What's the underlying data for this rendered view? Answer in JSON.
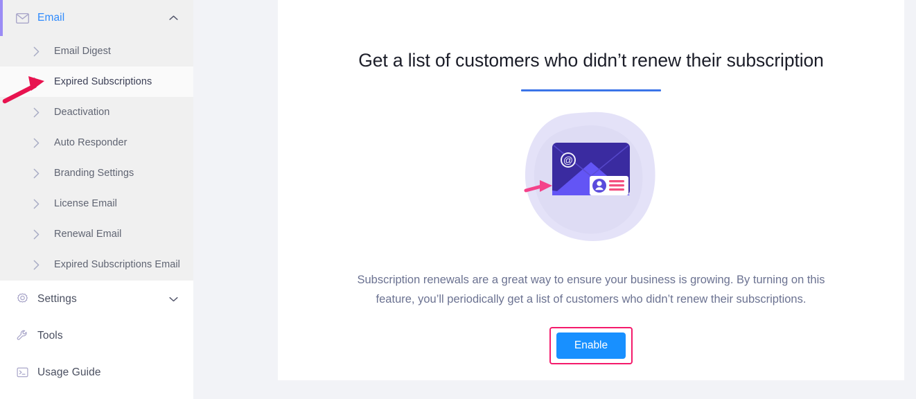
{
  "sidebar": {
    "group": {
      "label": "Email",
      "icon": "envelope-icon",
      "chevron": "chevron-up-icon",
      "expanded": true,
      "accent_color": "#9b8cf5",
      "label_color": "#2f8bfd"
    },
    "subitems": [
      {
        "label": "Email Digest",
        "icon": "chevron-right-icon",
        "active": false
      },
      {
        "label": "Expired Subscriptions",
        "icon": "chevron-right-icon",
        "active": true
      },
      {
        "label": "Deactivation",
        "icon": "chevron-right-icon",
        "active": false
      },
      {
        "label": "Auto Responder",
        "icon": "chevron-right-icon",
        "active": false
      },
      {
        "label": "Branding Settings",
        "icon": "chevron-right-icon",
        "active": false
      },
      {
        "label": "License Email",
        "icon": "chevron-right-icon",
        "active": false
      },
      {
        "label": "Renewal Email",
        "icon": "chevron-right-icon",
        "active": false
      },
      {
        "label": "Expired Subscriptions Email",
        "icon": "chevron-right-icon",
        "active": false
      }
    ],
    "main_items": [
      {
        "label": "Settings",
        "icon": "gear-icon",
        "chevron": "chevron-down-icon"
      },
      {
        "label": "Tools",
        "icon": "wrench-icon",
        "chevron": ""
      },
      {
        "label": "Usage Guide",
        "icon": "terminal-icon",
        "chevron": ""
      }
    ]
  },
  "main": {
    "title": "Get a list of customers who didn’t renew their subscription",
    "underline_color": "#3b74e8",
    "description": "Subscription renewals are a great way to ensure your business is growing. By turning on this feature, you’ll periodically get a list of customers who didn’t renew their subscriptions.",
    "enable_label": "Enable",
    "enable_color": "#1890ff",
    "highlight_color": "#f41a6b",
    "illustration": {
      "name": "email-contact-illustration",
      "blob_color": "#e2e0f7",
      "envelope_body_color": "#3a2ba0",
      "envelope_flap_color": "#6355f5",
      "at_symbol": "@",
      "card_line_color": "#f4507f"
    }
  },
  "annotations": {
    "sidebar_arrow": {
      "name": "red-pointer-arrow",
      "color": "#e8134f"
    },
    "illustration_arrow": {
      "name": "pink-pointer-arrow",
      "color": "#f4428a"
    }
  }
}
